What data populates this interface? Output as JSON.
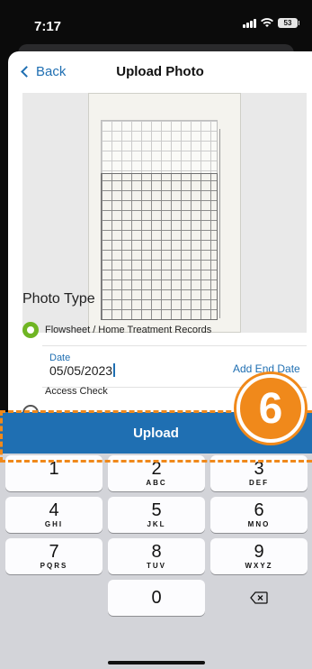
{
  "status_bar": {
    "time": "7:17",
    "battery": "53"
  },
  "nav": {
    "back_label": "Back",
    "title": "Upload Photo"
  },
  "photo_type": {
    "heading": "Photo Type",
    "options": [
      {
        "label": "Flowsheet / Home Treatment Records",
        "selected": true
      },
      {
        "label": "Access Check",
        "selected": false
      }
    ]
  },
  "date_field": {
    "label": "Date",
    "value": "05/05/2023",
    "end_date_link": "Add End Date"
  },
  "upload_button": {
    "label": "Upload"
  },
  "annotation": {
    "step": "6",
    "color": "#f0891b"
  },
  "keypad": {
    "keys": [
      {
        "num": "1",
        "letters": ""
      },
      {
        "num": "2",
        "letters": "ABC"
      },
      {
        "num": "3",
        "letters": "DEF"
      },
      {
        "num": "4",
        "letters": "GHI"
      },
      {
        "num": "5",
        "letters": "JKL"
      },
      {
        "num": "6",
        "letters": "MNO"
      },
      {
        "num": "7",
        "letters": "PQRS"
      },
      {
        "num": "8",
        "letters": "TUV"
      },
      {
        "num": "9",
        "letters": "WXYZ"
      },
      {
        "num": "0",
        "letters": ""
      }
    ],
    "delete_icon": "backspace-icon"
  },
  "colors": {
    "accent": "#1f6fb2",
    "selected": "#6fb523"
  }
}
